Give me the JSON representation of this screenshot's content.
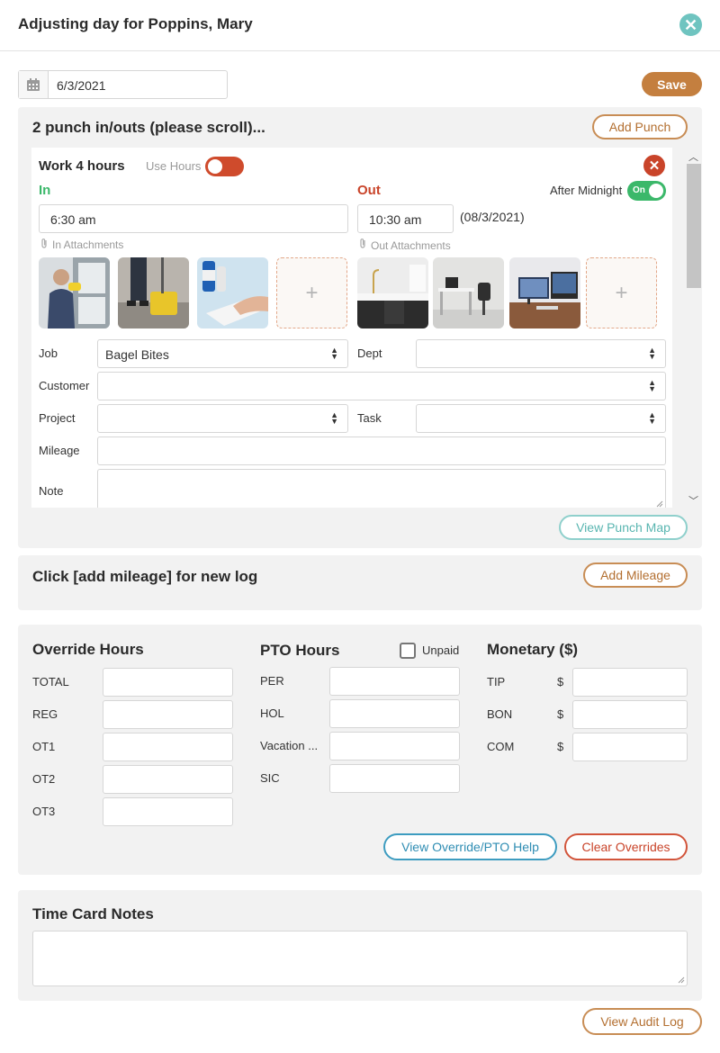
{
  "header": {
    "title": "Adjusting day for Poppins, Mary"
  },
  "date": {
    "value": "6/3/2021"
  },
  "toolbar": {
    "save_label": "Save"
  },
  "punch_panel": {
    "title": "2 punch in/outs (please scroll)...",
    "add_punch_label": "Add Punch",
    "view_map_label": "View Punch Map"
  },
  "punch": {
    "title": "Work 4 hours",
    "use_hours_label": "Use Hours",
    "in_label": "In",
    "out_label": "Out",
    "after_midnight_label": "After Midnight",
    "after_midnight_toggle": "On",
    "in_time": "6:30 am",
    "out_time": "10:30 am",
    "out_date": "(08/3/2021)",
    "in_attachments_label": "In Attachments",
    "out_attachments_label": "Out Attachments",
    "add_symbol": "+",
    "job_label": "Job",
    "job_value": "Bagel Bites",
    "dept_label": "Dept",
    "customer_label": "Customer",
    "project_label": "Project",
    "task_label": "Task",
    "mileage_label": "Mileage",
    "note_label": "Note"
  },
  "mileage_panel": {
    "title": "Click [add mileage] for new log",
    "add_label": "Add Mileage"
  },
  "overrides": {
    "override_title": "Override Hours",
    "override_rows": [
      "TOTAL",
      "REG",
      "OT1",
      "OT2",
      "OT3"
    ],
    "pto_title": "PTO Hours",
    "unpaid_label": "Unpaid",
    "pto_rows": [
      "PER",
      "HOL",
      "Vacation ...",
      "SIC"
    ],
    "monetary_title": "Monetary ($)",
    "monetary_rows": [
      "TIP",
      "BON",
      "COM"
    ],
    "currency_symbol": "$",
    "help_label": "View Override/PTO Help",
    "clear_label": "Clear Overrides"
  },
  "notes": {
    "title": "Time Card Notes"
  },
  "footer": {
    "audit_label": "View Audit Log"
  },
  "colors": {
    "accent": "#c47f3f",
    "teal": "#6fc4c0",
    "in_green": "#3bb86a",
    "out_red": "#c9442a"
  }
}
